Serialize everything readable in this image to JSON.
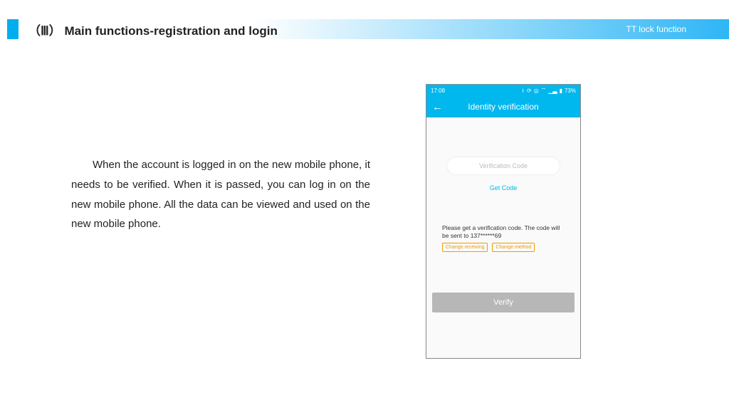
{
  "header": {
    "title": "（Ⅲ） Main functions-registration and login",
    "right": "TT lock function"
  },
  "description": "When the account is logged in on the new mobile phone, it needs to be verified. When it is passed, you can log in on the new mobile phone. All the data can be viewed and used on the new mobile phone.",
  "phone": {
    "status": {
      "time": "17:08",
      "battery": "73%"
    },
    "title": "Identity verification",
    "input_placeholder": "Verification Code",
    "get_code": "Get Code",
    "instruction": "Please get a verification code. The code will be sent to 137******69",
    "chip1": "Change receiving",
    "chip2": "Change method",
    "verify": "Verify"
  }
}
